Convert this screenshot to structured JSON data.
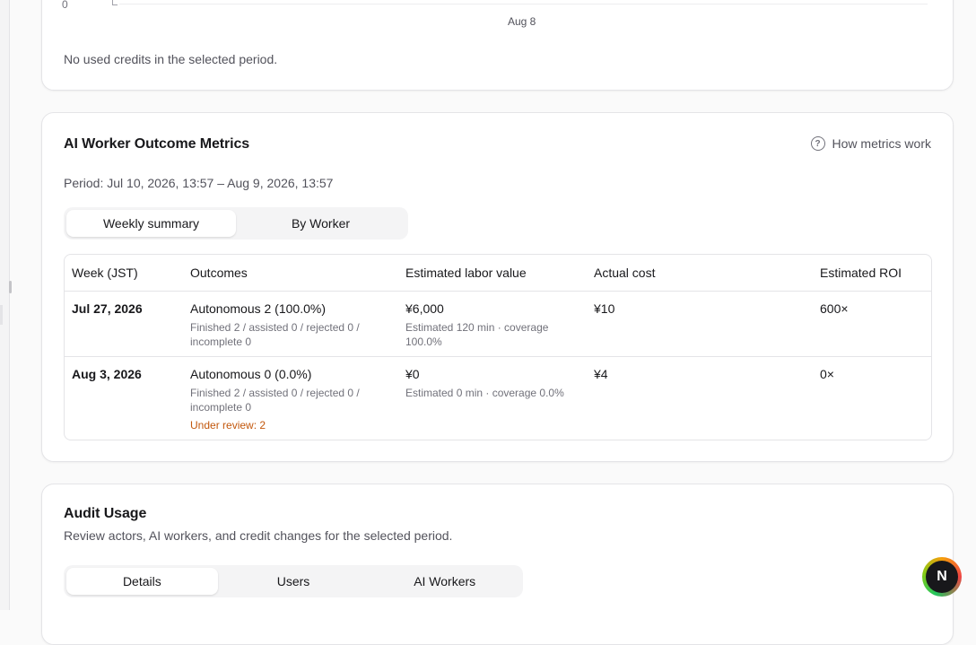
{
  "credits_chart": {
    "y_tick": "0",
    "x_tick": "Aug 8",
    "empty_message": "No used credits in the selected period."
  },
  "metrics": {
    "title": "AI Worker Outcome Metrics",
    "help_label": "How metrics work",
    "help_icon": "question-circle-icon",
    "period": "Period: Jul 10, 2026, 13:57 – Aug 9, 2026, 13:57",
    "tabs": [
      {
        "label": "Weekly summary",
        "active": true
      },
      {
        "label": "By Worker",
        "active": false
      }
    ],
    "columns": [
      "Week (JST)",
      "Outcomes",
      "Estimated labor value",
      "Actual cost",
      "Estimated ROI"
    ],
    "rows": [
      {
        "week": "Jul 27, 2026",
        "outcome": "Autonomous 2 (100.0%)",
        "outcome_detail": "Finished 2 / assisted 0 / rejected 0 / incomplete 0",
        "review": "",
        "labor_value": "¥6,000",
        "labor_detail": "Estimated 120 min · coverage 100.0%",
        "cost": "¥10",
        "roi": "600×"
      },
      {
        "week": "Aug 3, 2026",
        "outcome": "Autonomous 0 (0.0%)",
        "outcome_detail": "Finished 2 / assisted 0 / rejected 0 / incomplete 0",
        "review": "Under review: 2",
        "labor_value": "¥0",
        "labor_detail": "Estimated 0 min · coverage 0.0%",
        "cost": "¥4",
        "roi": "0×"
      }
    ]
  },
  "audit": {
    "title": "Audit Usage",
    "subtitle": "Review actors, AI workers, and credit changes for the selected period.",
    "tabs": [
      {
        "label": "Details",
        "active": true
      },
      {
        "label": "Users",
        "active": false
      },
      {
        "label": "AI Workers",
        "active": false
      }
    ]
  },
  "fab": {
    "label": "N"
  },
  "colors": {
    "warning": "#c2570c",
    "border": "#e4e4e7",
    "muted": "#71717a"
  }
}
